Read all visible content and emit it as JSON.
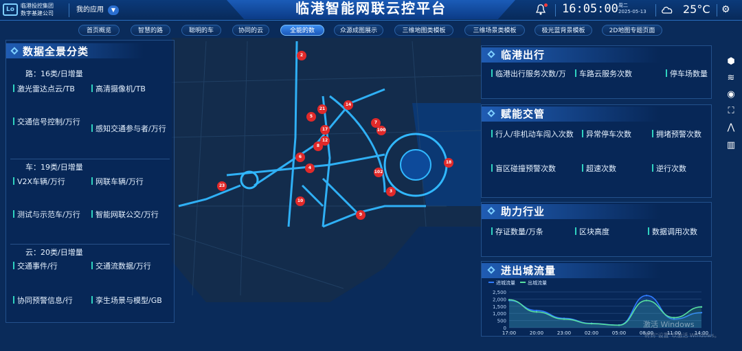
{
  "header": {
    "org_line1": "临港投控集团",
    "org_line2": "数字基建公司",
    "apps_label": "我的应用",
    "title": "临港智能网联云控平台",
    "time": "16:05:00",
    "weekday": "周二",
    "date": "2025-05-13",
    "temperature": "25°C"
  },
  "tabs": [
    {
      "label": "首页概览"
    },
    {
      "label": "智慧的路"
    },
    {
      "label": "聪明的车"
    },
    {
      "label": "协同的云"
    },
    {
      "label": "全能的数",
      "active": true
    },
    {
      "label": "众源成图展示"
    },
    {
      "label": "三维地图类模板"
    },
    {
      "label": "三维场景类模板"
    },
    {
      "label": "极光蓝背景模板"
    },
    {
      "label": "2D地图专题页面"
    }
  ],
  "left_panel": {
    "title": "数据全景分类",
    "sections": [
      {
        "heading": "路：16类/日增量",
        "metrics": [
          {
            "label": "激光雷达点云/TB",
            "value": ""
          },
          {
            "label": "高清摄像机/TB",
            "value": ""
          },
          {
            "label": "交通信号控制/万行",
            "value": ""
          },
          {
            "label": "感知交通参与者/万行",
            "value": ""
          }
        ]
      },
      {
        "heading": "车：19类/日增量",
        "metrics": [
          {
            "label": "V2X车辆/万行",
            "value": ""
          },
          {
            "label": "网联车辆/万行",
            "value": ""
          },
          {
            "label": "测试与示范车/万行",
            "value": ""
          },
          {
            "label": "智能网联公交/万行",
            "value": ""
          }
        ]
      },
      {
        "heading": "云：20类/日增量",
        "metrics": [
          {
            "label": "交通事件/行",
            "value": ""
          },
          {
            "label": "交通流数据/万行",
            "value": ""
          },
          {
            "label": "协同预警信息/行",
            "value": ""
          },
          {
            "label": "孪生场景与模型/GB",
            "value": ""
          }
        ]
      }
    ]
  },
  "right_panels": {
    "travel": {
      "title": "临港出行",
      "metrics": [
        {
          "label": "临港出行服务次数/万",
          "value": ""
        },
        {
          "label": "车路云服务次数",
          "value": ""
        },
        {
          "label": "停车场数量",
          "value": ""
        }
      ]
    },
    "traffic": {
      "title": "赋能交管",
      "metrics": [
        {
          "label": "行人/非机动车闯入次数",
          "value": ""
        },
        {
          "label": "异常停车次数",
          "value": ""
        },
        {
          "label": "拥堵预警次数",
          "value": ""
        },
        {
          "label": "盲区碰撞预警次数",
          "value": ""
        },
        {
          "label": "超速次数",
          "value": ""
        },
        {
          "label": "逆行次数",
          "value": ""
        }
      ]
    },
    "industry": {
      "title": "助力行业",
      "metrics": [
        {
          "label": "存证数量/万条",
          "value": ""
        },
        {
          "label": "区块高度",
          "value": ""
        },
        {
          "label": "数据调用次数",
          "value": ""
        }
      ]
    },
    "flow": {
      "title": "进出城流量"
    }
  },
  "chart_data": {
    "type": "area",
    "title": "进出城流量",
    "x": [
      "17:00",
      "20:00",
      "23:00",
      "02:00",
      "05:00",
      "08:00",
      "11:00",
      "14:00"
    ],
    "ylim": [
      0,
      2500
    ],
    "yticks": [
      "2,500",
      "2,000",
      "1,500",
      "1,000",
      "500",
      "0"
    ],
    "xticks": [
      "17:00",
      "20:00",
      "23:00",
      "02:00",
      "05:00",
      "08:00",
      "11:00",
      "14:00"
    ],
    "legend_position": "top-left",
    "series": [
      {
        "name": "进城流量",
        "color": "#2f7bff",
        "values": [
          1900,
          1200,
          650,
          300,
          180,
          2250,
          600,
          1050
        ]
      },
      {
        "name": "出城流量",
        "color": "#58e0a0",
        "values": [
          1950,
          1100,
          600,
          280,
          170,
          1900,
          700,
          1450
        ]
      }
    ]
  },
  "map_markers": [
    "2",
    "14",
    "21",
    "5",
    "17",
    "12",
    "8",
    "6",
    "23",
    "100",
    "7",
    "4",
    "102",
    "3",
    "9",
    "18",
    "10"
  ],
  "watermark": {
    "line1": "激活 Windows",
    "line2": "转到\"设置\"以激活 Windows。"
  },
  "icons": {
    "bell": "bell-icon",
    "cloud": "cloud-icon",
    "settings": "gear-icon",
    "tools": [
      "cube-icon",
      "layers-icon",
      "eye-icon",
      "fullscreen-icon",
      "road-icon",
      "columns-icon"
    ]
  }
}
